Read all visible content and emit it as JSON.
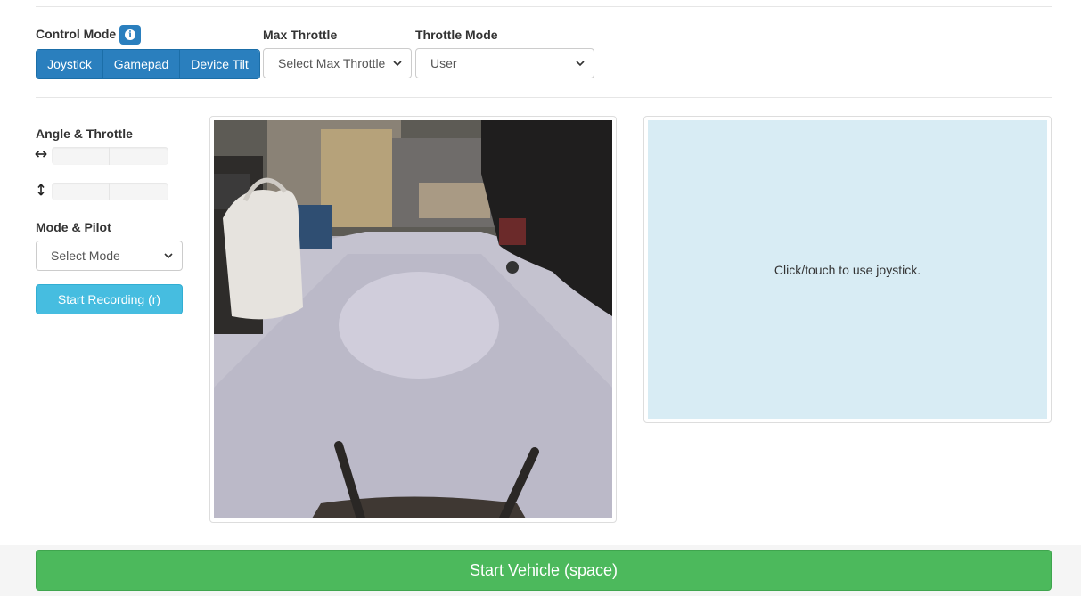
{
  "control_mode": {
    "label": "Control Mode",
    "info_icon": "info-icon",
    "options": [
      "Joystick",
      "Gamepad",
      "Device Tilt"
    ]
  },
  "max_throttle": {
    "label": "Max Throttle",
    "value": "Select Max Throttle"
  },
  "throttle_mode": {
    "label": "Throttle Mode",
    "value": "User"
  },
  "angle_throttle": {
    "label": "Angle & Throttle",
    "angle_icon": "horizontal-arrow-icon",
    "throttle_icon": "vertical-arrow-icon",
    "angle_level": 0,
    "throttle_level": 0
  },
  "mode_pilot": {
    "label": "Mode & Pilot",
    "value": "Select Mode"
  },
  "record_button": "Start Recording (r)",
  "camera": {
    "feed_icon": "camera-feed-image"
  },
  "joystick": {
    "hint": "Click/touch to use joystick."
  },
  "start_button": "Start Vehicle (space)",
  "colors": {
    "primary": "#2a7fbe",
    "info": "#46bde0",
    "success": "#4cb95c",
    "joystick_bg": "#d8ecf4"
  }
}
